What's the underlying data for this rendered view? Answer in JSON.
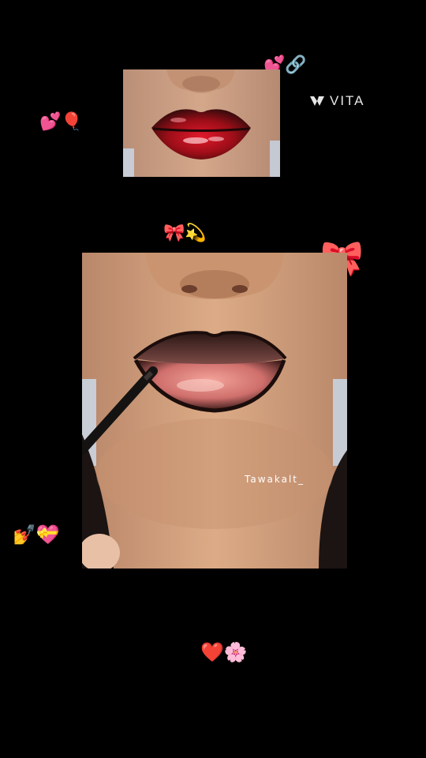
{
  "brand": {
    "name": "VITA"
  },
  "emoji_groups": [
    {
      "id": "top-right",
      "glyphs": "💕🔗"
    },
    {
      "id": "left-upper",
      "glyphs": "💕🎈"
    },
    {
      "id": "middle",
      "glyphs": "🎀💫"
    },
    {
      "id": "right-bow",
      "glyphs": "🎀"
    },
    {
      "id": "left-lower",
      "glyphs": "💅💝"
    },
    {
      "id": "bottom",
      "glyphs": "❤️🌸"
    }
  ],
  "photos": {
    "top": {
      "description_name": "red-gloss-lips-photo"
    },
    "main": {
      "watermark": "Tawakalt_"
    }
  },
  "colors": {
    "background": "#000000",
    "skin": "#d9a57e",
    "lip_liner": "#2a1714",
    "lip_red": "#b3101c",
    "lip_pink": "#e58a86"
  }
}
